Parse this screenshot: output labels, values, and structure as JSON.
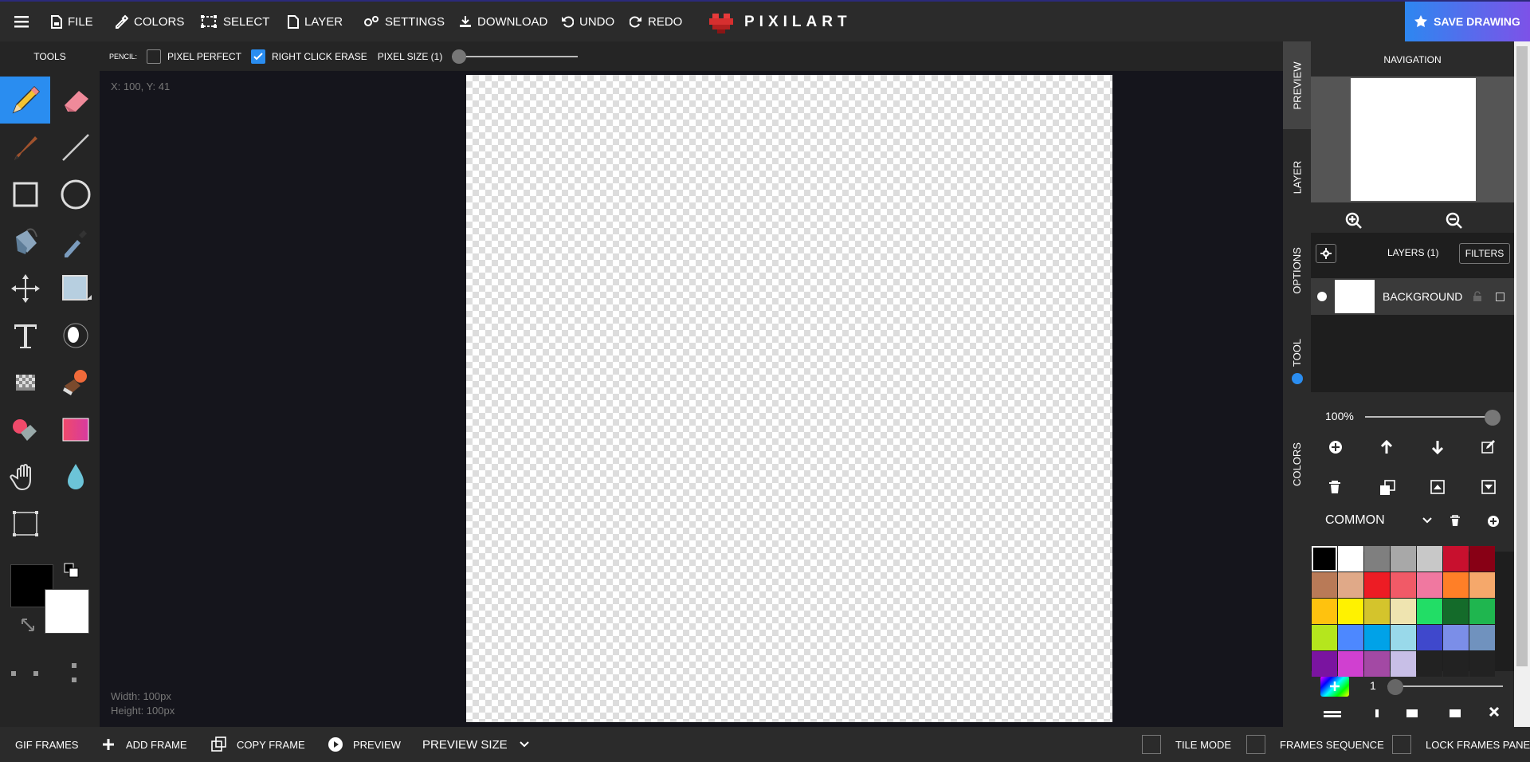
{
  "menu": {
    "file": "FILE",
    "colors": "COLORS",
    "select": "SELECT",
    "layer": "LAYER",
    "settings": "SETTINGS",
    "download": "DOWNLOAD",
    "undo": "UNDO",
    "redo": "REDO",
    "logo": "PIXILART",
    "save": "SAVE DRAWING"
  },
  "toolbar": {
    "title": "TOOLS"
  },
  "options": {
    "tool_label": "PENCIL:",
    "pixel_perfect": "PIXEL PERFECT",
    "pixel_perfect_checked": false,
    "right_click_erase": "RIGHT CLICK ERASE",
    "right_click_erase_checked": true,
    "pixel_size": "PIXEL SIZE (1)",
    "pixel_size_value": 1
  },
  "canvas": {
    "coords": "X: 100, Y: 41",
    "width": "Width: 100px",
    "height": "Height: 100px"
  },
  "side_tabs": {
    "preview": "PREVIEW",
    "layer": "LAYER",
    "options": "OPTIONS",
    "tool": "TOOL",
    "colors": "COLORS"
  },
  "navigation": {
    "title": "NAVIGATION"
  },
  "layers": {
    "title": "LAYERS (1)",
    "filters": "FILTERS",
    "items": [
      {
        "name": "BACKGROUND"
      }
    ],
    "opacity": "100%"
  },
  "palette": {
    "name": "COMMON",
    "brush_size": "1",
    "colors": [
      "#000000",
      "#ffffff",
      "#7f7f7f",
      "#a8a8a8",
      "#c8c8c8",
      "#c8102e",
      "#880015",
      "#b97a57",
      "#e0a988",
      "#ed1c24",
      "#f15a67",
      "#f078a0",
      "#ff7f27",
      "#f5a86b",
      "#ffc20e",
      "#fff200",
      "#d4c42c",
      "#efe4b0",
      "#22dd66",
      "#146b2a",
      "#1fb64f",
      "#b5e61d",
      "#4d88ff",
      "#00a2e8",
      "#99d9ea",
      "#3f48cc",
      "#7b8ee8",
      "#7092be",
      "#7a14a0",
      "#d040d0",
      "#a349a4",
      "#c8bfe7",
      "#222222",
      "#222222",
      "#222222"
    ]
  },
  "primary_color": "#000000",
  "secondary_color": "#ffffff",
  "bottom": {
    "gif_frames": "GIF FRAMES",
    "add_frame": "ADD FRAME",
    "copy_frame": "COPY FRAME",
    "preview": "PREVIEW",
    "preview_size": "PREVIEW SIZE",
    "tile_mode": "TILE MODE",
    "frames_sequence": "FRAMES SEQUENCE",
    "lock_frames_panel": "LOCK FRAMES PANEL"
  }
}
